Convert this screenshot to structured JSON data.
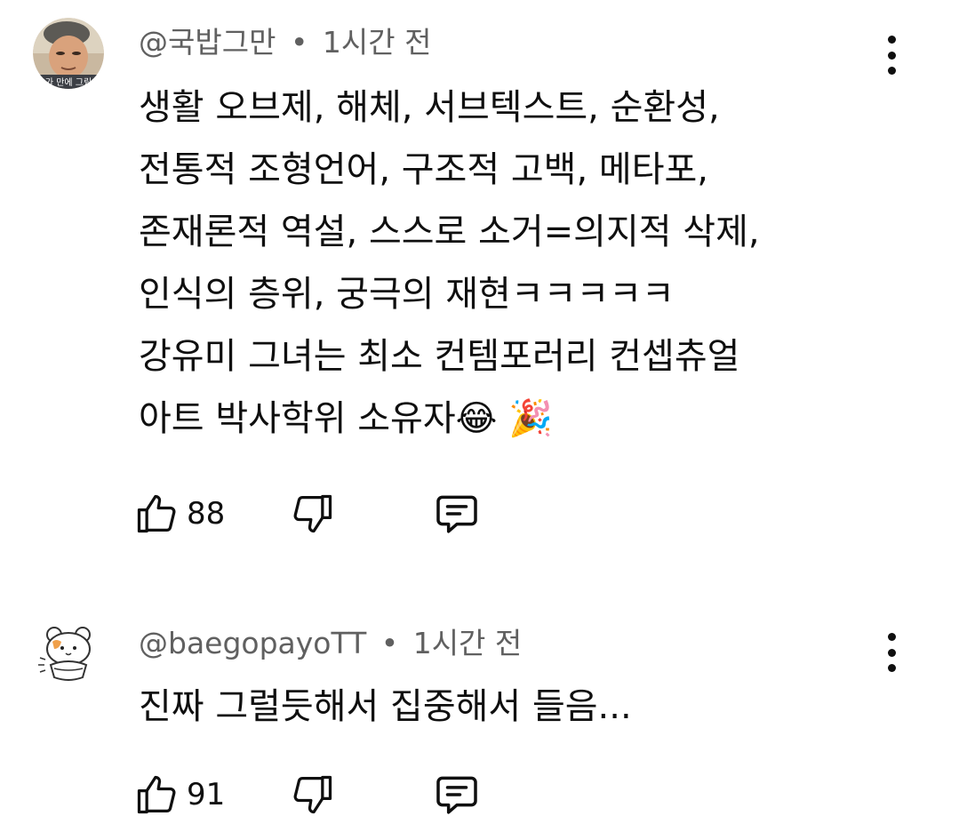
{
  "comments": [
    {
      "author": "@국밥그만",
      "separator": "•",
      "time": "1시간 전",
      "lines": [
        "생활 오브제, 해체, 서브텍스트, 순환성,",
        "전통적 조형언어, 구조적 고백, 메타포,",
        "존재론적 역설, 스스로 소거=의지적 삭제,",
        "인식의 층위, 궁극의 재현ㅋㅋㅋㅋㅋ",
        "강유미 그녀는 최소 컨템포러리 컨셉츄얼",
        "아트 박사학위 소유자😂 🎉"
      ],
      "like_count": "88",
      "avatar_icon": "user-photo-avatar",
      "avatar_caption": "가 만에 그림"
    },
    {
      "author": "@baegopayoTT",
      "separator": "•",
      "time": "1시간 전",
      "lines": [
        "진짜 그럴듯해서 집중해서 들음..."
      ],
      "like_count": "91",
      "avatar_icon": "hamster-illustration-avatar"
    }
  ],
  "icons": {
    "like": "thumb-up-icon",
    "dislike": "thumb-down-icon",
    "reply": "reply-comment-icon",
    "menu": "more-vertical-icon"
  },
  "colors": {
    "text_primary": "#0f0f0f",
    "text_secondary": "#606060",
    "background": "#ffffff"
  }
}
